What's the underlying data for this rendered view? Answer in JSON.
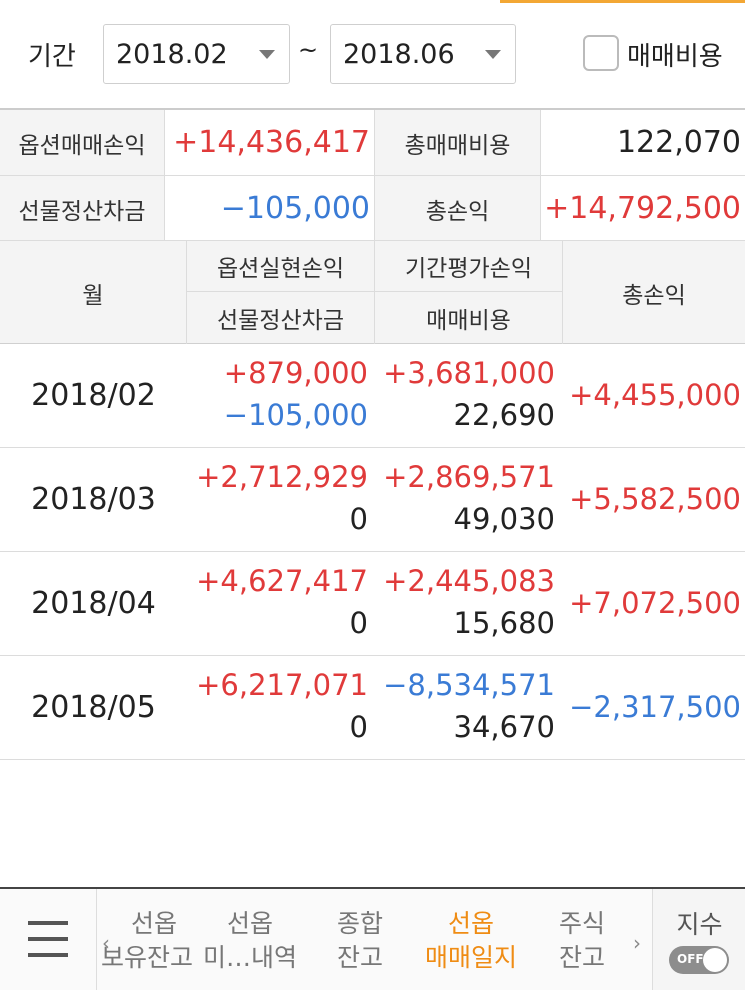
{
  "filter": {
    "period_label": "기간",
    "start": "2018.02",
    "separator": "~",
    "end": "2018.06",
    "fee_checkbox_label": "매매비용",
    "fee_checked": false
  },
  "summary": {
    "option_pnl_label": "옵션매매손익",
    "option_pnl_value": "+14,436,417",
    "total_fee_label": "총매매비용",
    "total_fee_value": "122,070",
    "futures_settle_label": "선물정산차금",
    "futures_settle_value": "−105,000",
    "total_pnl_label": "총손익",
    "total_pnl_value": "+14,792,500"
  },
  "list_header": {
    "month": "월",
    "option_realized": "옵션실현손익",
    "futures_settle": "선물정산차금",
    "period_eval": "기간평가손익",
    "fee": "매매비용",
    "total": "총손익"
  },
  "rows": [
    {
      "month": "2018/02",
      "option_realized": "+879,000",
      "futures_settle": "−105,000",
      "period_eval": "+3,681,000",
      "fee": "22,690",
      "total": "+4,455,000"
    },
    {
      "month": "2018/03",
      "option_realized": "+2,712,929",
      "futures_settle": "0",
      "period_eval": "+2,869,571",
      "fee": "49,030",
      "total": "+5,582,500"
    },
    {
      "month": "2018/04",
      "option_realized": "+4,627,417",
      "futures_settle": "0",
      "period_eval": "+2,445,083",
      "fee": "15,680",
      "total": "+7,072,500"
    },
    {
      "month": "2018/05",
      "option_realized": "+6,217,071",
      "futures_settle": "0",
      "period_eval": "−8,534,571",
      "fee": "34,670",
      "total": "−2,317,500"
    }
  ],
  "bottom_nav": {
    "menu_icon": "hamburger-menu-icon",
    "tabs": [
      {
        "line1": "선옵",
        "line2": "보유잔고"
      },
      {
        "line1": "선옵",
        "line2": "미…내역"
      },
      {
        "line1": "종합",
        "line2": "잔고"
      },
      {
        "line1": "선옵",
        "line2": "매매일지"
      },
      {
        "line1": "주식",
        "line2": "잔고"
      }
    ],
    "active_tab": 3,
    "index_label": "지수",
    "index_toggle": "OFF"
  },
  "colors": {
    "positive": "#e03a3a",
    "negative": "#3a7bd5",
    "active_tab": "#ef8c14",
    "accent_line": "#f3a734"
  }
}
